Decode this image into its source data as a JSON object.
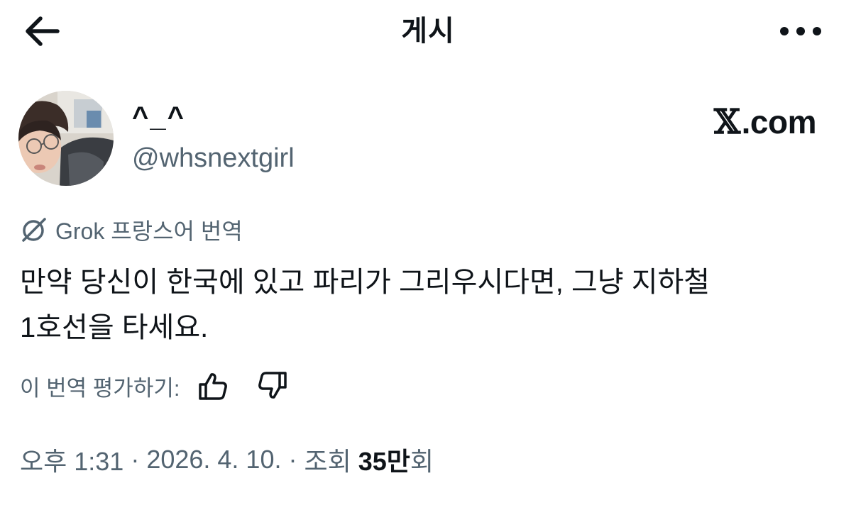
{
  "header": {
    "title": "게시",
    "back_icon": "arrow-left-icon",
    "more_icon": "more-horizontal-icon"
  },
  "author": {
    "display_name": "^_^",
    "handle": "@whsnextgirl"
  },
  "site_badge": {
    "logo_glyph": "𝕏",
    "domain": ".com"
  },
  "translation": {
    "label": "Grok 프랑스어 번역",
    "icon": "grok-icon"
  },
  "tweet": {
    "line1": "만약 당신이 한국에 있고 파리가 그리우시다면, 그냥 지하철",
    "line2": "1호선을 타세요."
  },
  "rating": {
    "label": "이 번역 평가하기:",
    "thumbs_up_icon": "thumbs-up-icon",
    "thumbs_down_icon": "thumbs-down-icon"
  },
  "meta": {
    "time": "오후 1:31",
    "separator": "·",
    "date": "2026. 4. 10.",
    "views_label": "조회",
    "views_number": "35만",
    "views_suffix": "회"
  },
  "colors": {
    "text": "#0f1419",
    "secondary": "#536471",
    "background": "#ffffff"
  }
}
